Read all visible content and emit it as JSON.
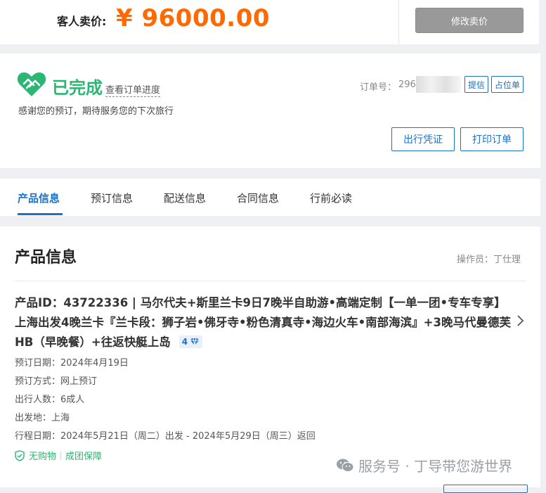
{
  "price": {
    "label": "客人卖价:",
    "value": "¥ 96000.00",
    "modify_btn": "修改卖价"
  },
  "status": {
    "title": "已完成",
    "progress_link": "查看订单进度",
    "thanks": "感谢您的预订，期待服务您的下次旅行",
    "order_no_label": "订单号：",
    "order_no_value": "296",
    "confirm_letter_btn": "提信",
    "seat_hold_btn": "占位单",
    "voucher_btn": "出行凭证",
    "print_btn": "打印订单",
    "accent_color": "#2bb673"
  },
  "tabs": [
    {
      "label": "产品信息",
      "active": true
    },
    {
      "label": "预订信息",
      "active": false
    },
    {
      "label": "配送信息",
      "active": false
    },
    {
      "label": "合同信息",
      "active": false
    },
    {
      "label": "行前必读",
      "active": false
    }
  ],
  "product": {
    "section_title": "产品信息",
    "operator": "操作员：丁仕理",
    "title": "产品ID：43722336 | 马尔代夫+斯里兰卡9日7晚半自助游•高端定制【一单一团•专车专享】上海出发4晚兰卡『兰卡段：狮子岩•佛牙寺•粉色清真寺•海边火车•南部海滨』+3晚马代曼德芙HB（早晚餐）+往返快艇上岛",
    "badge_count": "4",
    "rows": [
      {
        "label": "预订日期：",
        "value": "2024年4月19日"
      },
      {
        "label": "预订方式：",
        "value": "网上预订"
      },
      {
        "label": "出行人数：",
        "value": "6成人"
      },
      {
        "label": "出发地：",
        "value": "上海"
      },
      {
        "label": "行程日期：",
        "value": "2024年5月21日（周二）出发 - 2024年5月29日（周三）返回"
      }
    ],
    "guarantees": [
      "无购物",
      "成团保障"
    ]
  },
  "watermark": "服务号 · 丁导带您游世界",
  "colors": {
    "brand_blue": "#1a73c8",
    "price_orange": "#ff6a00",
    "success_green": "#2bb673"
  }
}
